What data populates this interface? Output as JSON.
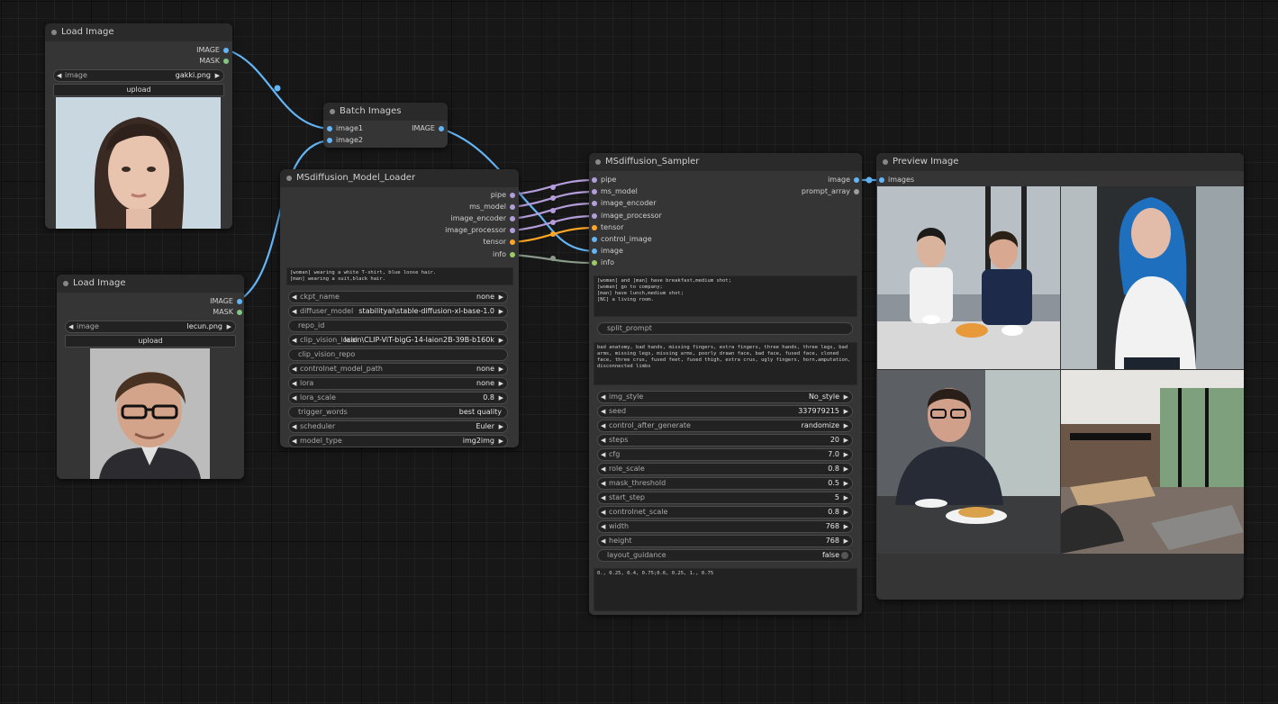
{
  "colors": {
    "image": "#64b5f6",
    "mask": "#81c784",
    "pipe": "#b39ddb",
    "tensor": "#ffa726",
    "info": "#9ccc65",
    "string": "#9e9e9e"
  },
  "load_image_1": {
    "title": "Load Image",
    "out_image": "IMAGE",
    "out_mask": "MASK",
    "image_label": "image",
    "image_value": "gakki.png",
    "upload": "upload"
  },
  "load_image_2": {
    "title": "Load Image",
    "out_image": "IMAGE",
    "out_mask": "MASK",
    "image_label": "image",
    "image_value": "lecun.png",
    "upload": "upload"
  },
  "batch_images": {
    "title": "Batch Images",
    "in_image1": "image1",
    "in_image2": "image2",
    "out_image": "IMAGE"
  },
  "model_loader": {
    "title": "MSdiffusion_Model_Loader",
    "outputs": [
      "pipe",
      "ms_model",
      "image_encoder",
      "image_processor",
      "tensor",
      "info"
    ],
    "prompt_text": "[woman] wearing a white T-shirt, blue loose hair.\n[man] wearing a suit,black hair.",
    "widgets": [
      {
        "label": "ckpt_name",
        "value": "none"
      },
      {
        "label": "diffuser_model",
        "value": "stabilityai\\stable-diffusion-xl-base-1.0"
      },
      {
        "label": "repo_id",
        "value": ""
      },
      {
        "label": "clip_vision_local",
        "value": "laion\\CLIP-ViT-bigG-14-laion2B-39B-b160k"
      },
      {
        "label": "clip_vision_repo",
        "value": ""
      },
      {
        "label": "controlnet_model_path",
        "value": "none"
      },
      {
        "label": "lora",
        "value": "none"
      },
      {
        "label": "lora_scale",
        "value": "0.8"
      },
      {
        "label": "trigger_words",
        "value": "best quality"
      },
      {
        "label": "scheduler",
        "value": "Euler"
      },
      {
        "label": "model_type",
        "value": "img2img"
      }
    ]
  },
  "sampler": {
    "title": "MSdiffusion_Sampler",
    "inputs": [
      "pipe",
      "ms_model",
      "image_encoder",
      "image_processor",
      "tensor",
      "control_image",
      "image",
      "info"
    ],
    "out_image": "image",
    "out_prompt_array": "prompt_array",
    "prompt_text": "[woman] and [man] have breakfast,medium shot;\n[woman] go to company;\n[man] have lunch,medium shot;\n[NC] a living room.",
    "split_prompt": "split_prompt",
    "negative_text": "bad anatomy, bad hands, missing fingers, extra fingers, three hands, three legs, bad arms, missing legs, missing arms, poorly drawn face, bad face, fused face, cloned face, three crus, fused feet, fused thigh, extra crus, ugly fingers, horn,amputation, disconnected limbs",
    "widgets": [
      {
        "label": "img_style",
        "value": "No_style"
      },
      {
        "label": "seed",
        "value": "337979215"
      },
      {
        "label": "control_after_generate",
        "value": "randomize"
      },
      {
        "label": "steps",
        "value": "20"
      },
      {
        "label": "cfg",
        "value": "7.0"
      },
      {
        "label": "role_scale",
        "value": "0.8"
      },
      {
        "label": "mask_threshold",
        "value": "0.5"
      },
      {
        "label": "start_step",
        "value": "5"
      },
      {
        "label": "controlnet_scale",
        "value": "0.8"
      },
      {
        "label": "width",
        "value": "768"
      },
      {
        "label": "height",
        "value": "768"
      }
    ],
    "layout_label": "layout_guidance",
    "layout_value": "false",
    "guidance_text": "0., 0.25, 0.4, 0.75;0.6, 0.25, 1., 0.75"
  },
  "preview": {
    "title": "Preview Image",
    "in_images": "images"
  }
}
